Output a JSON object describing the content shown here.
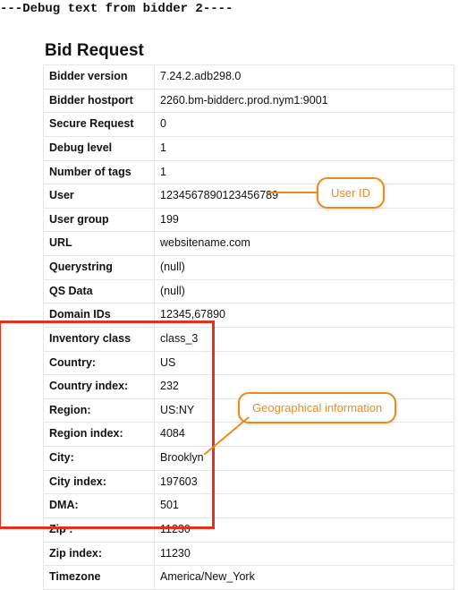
{
  "debug_header": "---Debug text from bidder 2----",
  "title": "Bid Request",
  "rows": [
    {
      "k": "Bidder version",
      "v": "7.24.2.adb298.0"
    },
    {
      "k": "Bidder hostport",
      "v": "2260.bm-bidderc.prod.nym1:9001"
    },
    {
      "k": "Secure Request",
      "v": "0"
    },
    {
      "k": "Debug level",
      "v": "1"
    },
    {
      "k": "Number of tags",
      "v": "1"
    },
    {
      "k": "User",
      "v": "1234567890123456789"
    },
    {
      "k": "User group",
      "v": "199"
    },
    {
      "k": "URL",
      "v": "websitename.com"
    },
    {
      "k": "Querystring",
      "v": "(null)"
    },
    {
      "k": "QS Data",
      "v": "(null)"
    },
    {
      "k": "Domain IDs",
      "v": "12345,67890"
    },
    {
      "k": "Inventory class",
      "v": "class_3"
    },
    {
      "k": "Country:",
      "v": "US"
    },
    {
      "k": "Country index:",
      "v": "232"
    },
    {
      "k": "Region:",
      "v": "US:NY"
    },
    {
      "k": "Region index:",
      "v": "4084"
    },
    {
      "k": "City:",
      "v": "Brooklyn"
    },
    {
      "k": "City index:",
      "v": "197603"
    },
    {
      "k": "DMA:",
      "v": "501"
    },
    {
      "k": "Zip :",
      "v": "11230"
    },
    {
      "k": "Zip index:",
      "v": "11230"
    },
    {
      "k": "Timezone",
      "v": "America/New_York"
    }
  ],
  "callouts": {
    "user_id": "User ID",
    "geo": "Geographical information"
  },
  "highlight": {
    "start_row_index": 12,
    "end_row_index": 20
  }
}
